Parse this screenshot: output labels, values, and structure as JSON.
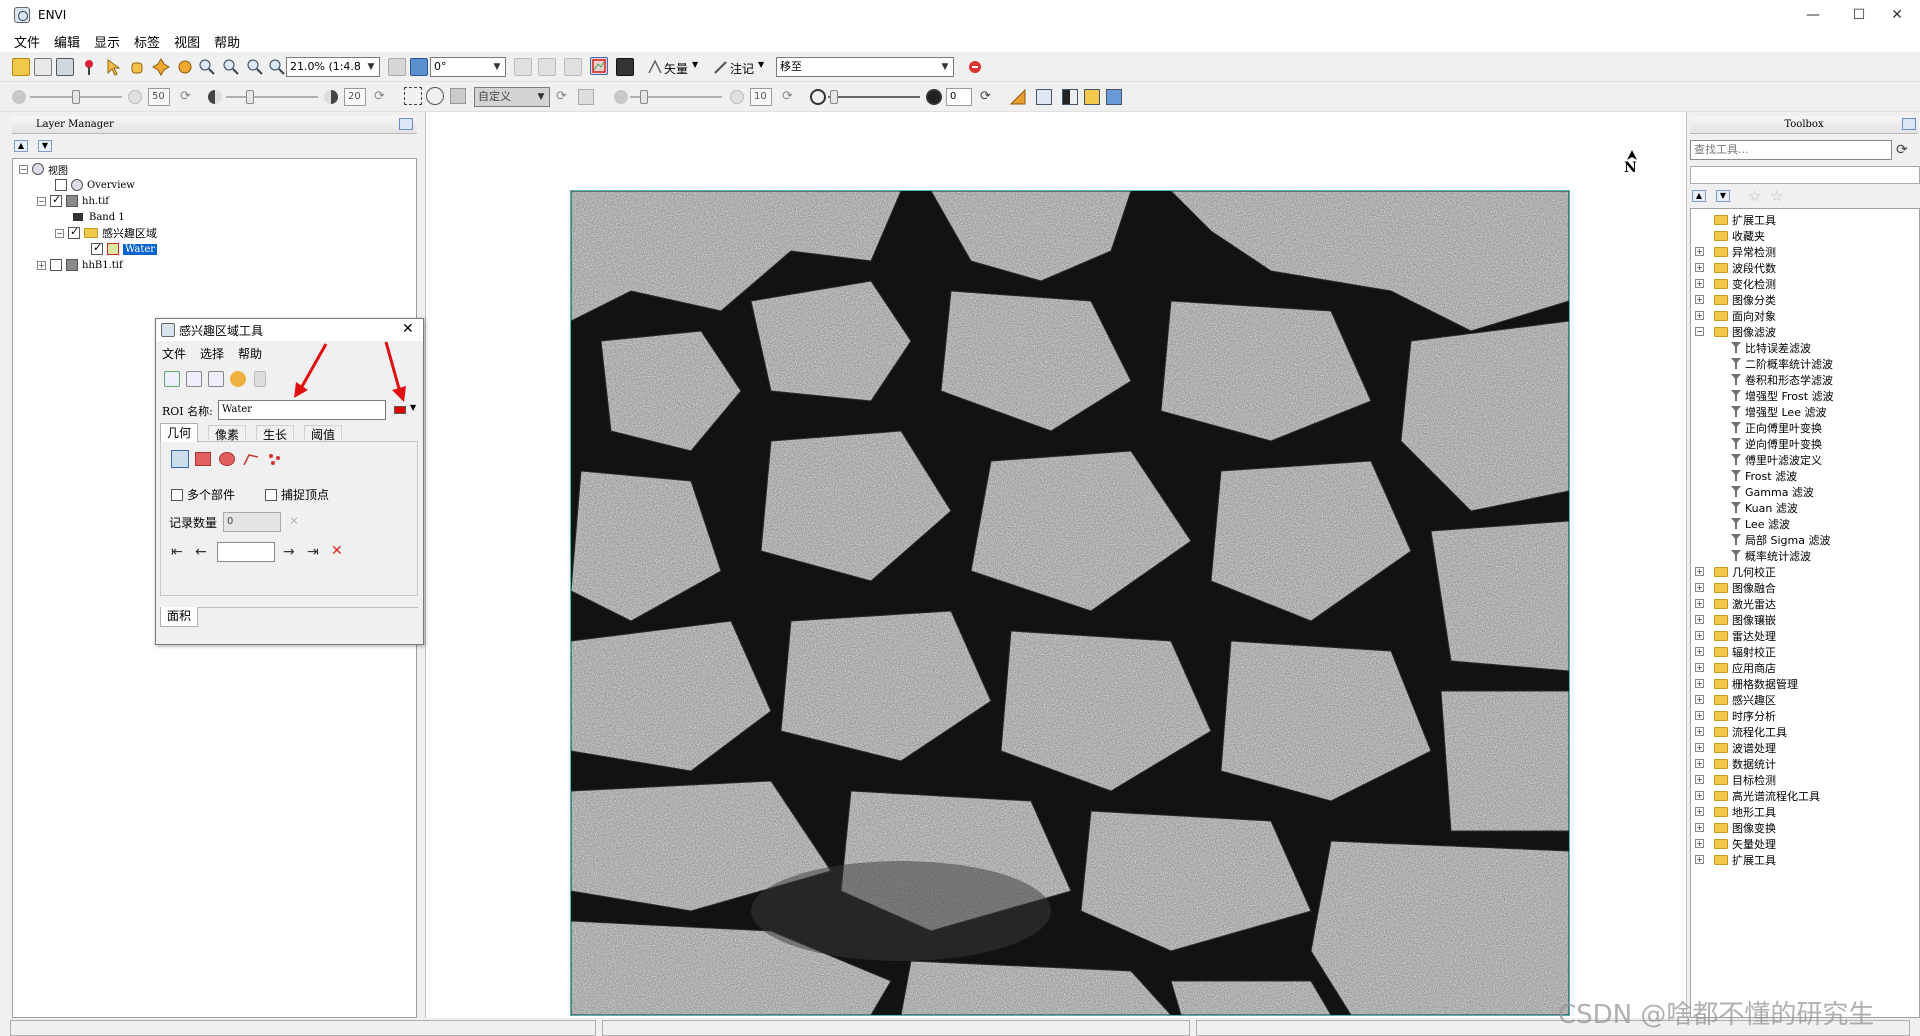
{
  "window": {
    "title": "ENVI",
    "min": "—",
    "max": "☐",
    "close": "✕"
  },
  "menu": [
    "文件",
    "编辑",
    "显示",
    "标签",
    "视图",
    "帮助"
  ],
  "toolbar1": {
    "zoom_value": "21.0% (1:4.8",
    "rotation_value": "0°",
    "vector_label": "矢量",
    "annotation_label": "注记",
    "cursor_mode_value": "移至"
  },
  "toolbar2": {
    "brightness_value": "50",
    "contrast_value": "20",
    "stretch_value": "自定义",
    "sharpen_value": "10",
    "transparency_value": "0"
  },
  "layer_manager": {
    "title": "Layer Manager",
    "tree": [
      {
        "label": "视图",
        "level": 0
      },
      {
        "label": "Overview",
        "level": 1
      },
      {
        "label": "hh.tif",
        "level": 1
      },
      {
        "label": "Band 1",
        "level": 2
      },
      {
        "label": "感兴趣区域",
        "level": 2
      },
      {
        "label": "Water",
        "level": 3,
        "selected": true
      },
      {
        "label": "hhB1.tif",
        "level": 1
      }
    ]
  },
  "roi_tool": {
    "title": "感兴趣区域工具",
    "menu": [
      "文件",
      "选择",
      "帮助"
    ],
    "roi_name_label": "ROI 名称:",
    "roi_name_value": "Water",
    "roi_color": "#e00000",
    "tabs": [
      "几何",
      "像素",
      "生长",
      "阈值"
    ],
    "active_tab": "几何",
    "multi_part_label": "多个部件",
    "snap_vertex_label": "捕捉顶点",
    "record_count_label": "记录数量",
    "record_count_value": "0",
    "bottom_tab": "面积"
  },
  "toolbox": {
    "title": "Toolbox",
    "search_placeholder": "查找工具...",
    "items": [
      {
        "label": "扩展工具",
        "type": "folder",
        "expander": false
      },
      {
        "label": "收藏夹",
        "type": "folder",
        "expander": false
      },
      {
        "label": "异常检测",
        "type": "folder",
        "expander": true
      },
      {
        "label": "波段代数",
        "type": "folder",
        "expander": true
      },
      {
        "label": "变化检测",
        "type": "folder",
        "expander": true
      },
      {
        "label": "图像分类",
        "type": "folder",
        "expander": true
      },
      {
        "label": "面向对象",
        "type": "folder",
        "expander": true
      },
      {
        "label": "图像滤波",
        "type": "folder",
        "expander": true,
        "open": true
      },
      {
        "label": "比特误差滤波",
        "type": "tool"
      },
      {
        "label": "二阶概率统计滤波",
        "type": "tool"
      },
      {
        "label": "卷积和形态学滤波",
        "type": "tool"
      },
      {
        "label": "增强型 Frost 滤波",
        "type": "tool"
      },
      {
        "label": "增强型 Lee 滤波",
        "type": "tool"
      },
      {
        "label": "正向傅里叶变换",
        "type": "tool"
      },
      {
        "label": "逆向傅里叶变换",
        "type": "tool"
      },
      {
        "label": "傅里叶滤波定义",
        "type": "tool"
      },
      {
        "label": "Frost 滤波",
        "type": "tool"
      },
      {
        "label": "Gamma 滤波",
        "type": "tool"
      },
      {
        "label": "Kuan 滤波",
        "type": "tool"
      },
      {
        "label": "Lee 滤波",
        "type": "tool"
      },
      {
        "label": "局部 Sigma 滤波",
        "type": "tool"
      },
      {
        "label": "概率统计滤波",
        "type": "tool"
      },
      {
        "label": "几何校正",
        "type": "folder",
        "expander": true
      },
      {
        "label": "图像融合",
        "type": "folder",
        "expander": true
      },
      {
        "label": "激光雷达",
        "type": "folder",
        "expander": true
      },
      {
        "label": "图像镶嵌",
        "type": "folder",
        "expander": true
      },
      {
        "label": "雷达处理",
        "type": "folder",
        "expander": true
      },
      {
        "label": "辐射校正",
        "type": "folder",
        "expander": true
      },
      {
        "label": "应用商店",
        "type": "folder",
        "expander": true
      },
      {
        "label": "栅格数据管理",
        "type": "folder",
        "expander": true
      },
      {
        "label": "感兴趣区",
        "type": "folder",
        "expander": true
      },
      {
        "label": "时序分析",
        "type": "folder",
        "expander": true
      },
      {
        "label": "流程化工具",
        "type": "folder",
        "expander": true
      },
      {
        "label": "波谱处理",
        "type": "folder",
        "expander": true
      },
      {
        "label": "数据统计",
        "type": "folder",
        "expander": true
      },
      {
        "label": "目标检测",
        "type": "folder",
        "expander": true
      },
      {
        "label": "高光谱流程化工具",
        "type": "folder",
        "expander": true
      },
      {
        "label": "地形工具",
        "type": "folder",
        "expander": true
      },
      {
        "label": "图像变换",
        "type": "folder",
        "expander": true
      },
      {
        "label": "矢量处理",
        "type": "folder",
        "expander": true
      },
      {
        "label": "扩展工具",
        "type": "folder",
        "expander": true
      }
    ]
  },
  "north_arrow": "N",
  "watermark": "CSDN @啥都不懂的研究生"
}
